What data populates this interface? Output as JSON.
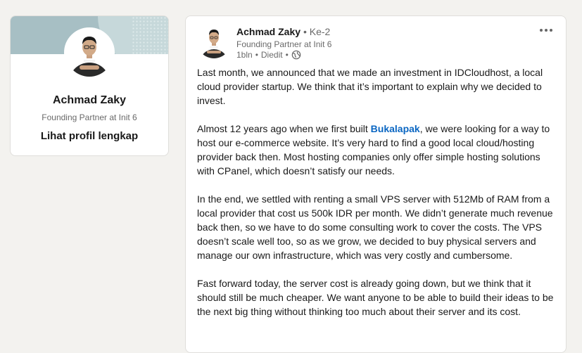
{
  "profile_card": {
    "name": "Achmad Zaky",
    "headline": "Founding Partner at Init 6",
    "view_profile_label": "Lihat profil lengkap"
  },
  "post": {
    "author": {
      "name": "Achmad Zaky",
      "degree": "• Ke-2",
      "headline": "Founding Partner at Init 6"
    },
    "meta": {
      "time": "1bln",
      "edited": "Diedit",
      "visibility_icon": "globe-icon"
    },
    "more_icon": "ellipsis-icon",
    "paragraphs": [
      {
        "text": "Last month, we announced that we made an investment in IDCloudhost, a local cloud provider startup. We think that it’s important to explain why we decided to invest."
      },
      {
        "before": "Almost 12 years ago when we first built ",
        "mention": "Bukalapak",
        "after": ", we were looking for a way to host our e-commerce website. It’s very hard to find a good local cloud/hosting provider back then. Most hosting companies only offer simple hosting solutions with CPanel, which doesn’t satisfy our needs."
      },
      {
        "text": "In the end, we settled with renting a small VPS server with 512Mb of RAM from a local provider that cost us 500k IDR per month. We didn’t generate much revenue back then, so we have to do some consulting work to cover the costs. The VPS doesn’t scale well too, so as we grow, we decided to buy physical servers and manage our own infrastructure, which was very costly and cumbersome."
      },
      {
        "text": "Fast forward today, the server cost is already going down, but we think that it should still be much cheaper. We want anyone to be able to build their ideas to be the next big thing without thinking too much about their server and its cost."
      }
    ]
  },
  "colors": {
    "page_bg": "#f3f2ef",
    "link_blue": "#0a66c2",
    "cover_bg": "#a7bfc4"
  }
}
